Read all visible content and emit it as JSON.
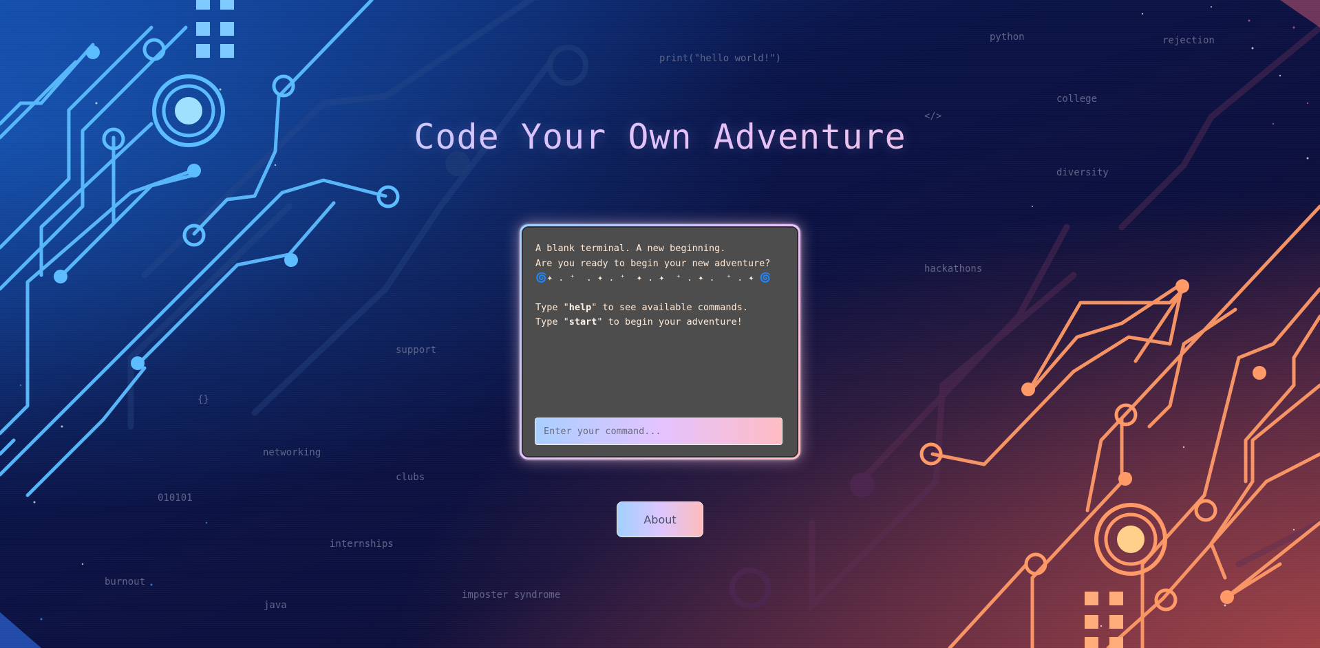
{
  "page": {
    "title": "Code Your Own Adventure"
  },
  "terminal": {
    "line1": "A blank terminal. A new beginning.",
    "line2": "Are you ready to begin your new adventure?",
    "line3": "🌀✦ . ⁺  . ✦ . ⁺  ✦ . ✦  ⁺ . ✦ .  ⁺ . ✦ 🌀",
    "help_prefix": "Type \"",
    "help_cmd": "help",
    "help_suffix": "\" to see available commands.",
    "start_prefix": "Type \"",
    "start_cmd": "start",
    "start_suffix": "\" to begin your adventure!",
    "input_placeholder": "Enter your command..."
  },
  "about_button": "About",
  "background_words": [
    "print(\"hello world!\")",
    "python",
    "rejection",
    "college",
    "</>",
    "diversity",
    "hackathons",
    "support",
    "{}",
    "networking",
    "clubs",
    "010101",
    "internships",
    "burnout",
    "java",
    "imposter syndrome"
  ],
  "colors": {
    "circuit_left": "#5bbcff",
    "circuit_right": "#ff9966",
    "terminal_bg": "#4d4d4d",
    "terminal_text": "#ffe9d6",
    "gradient_blue": "#a9d4ff",
    "gradient_violet": "#e7c3ff",
    "gradient_pink": "#ffc7c7"
  }
}
